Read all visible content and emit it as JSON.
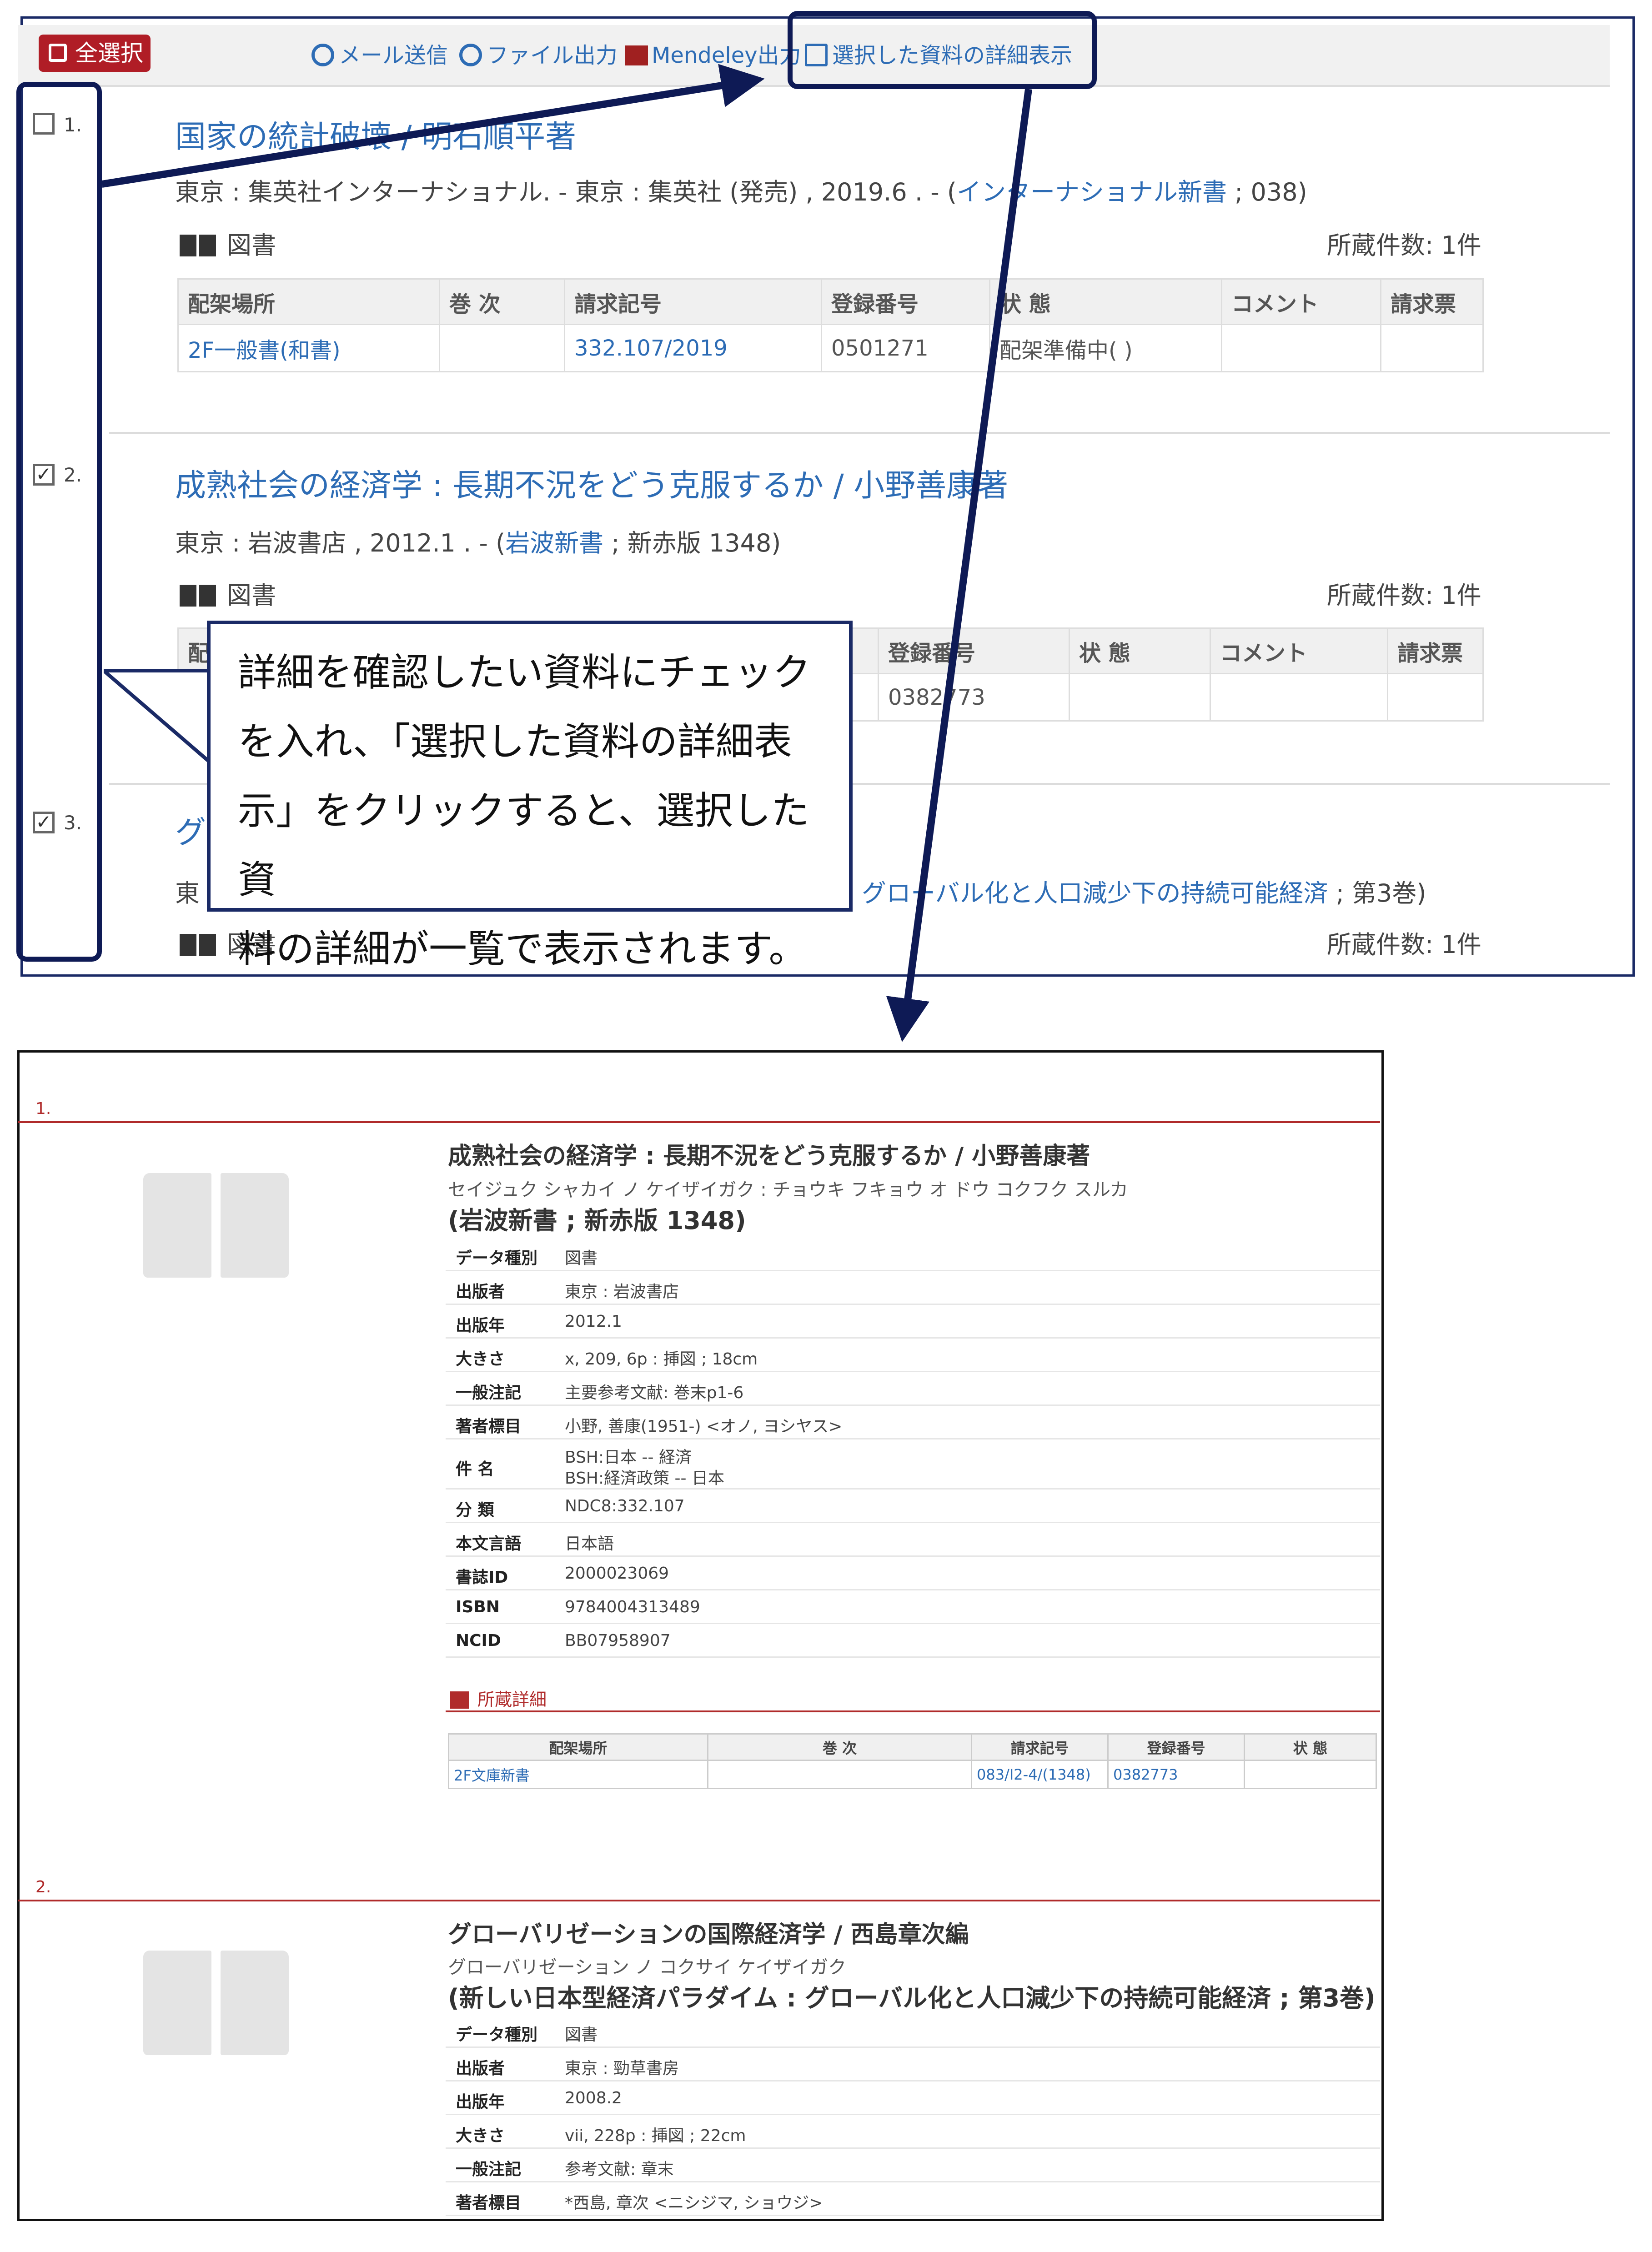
{
  "toolbar": {
    "select_all": "全選択",
    "mail": "メール送信",
    "file": "ファイル出力",
    "mendeley": "Mendeley出力",
    "detail": "選択した資料の詳細表示"
  },
  "results": [
    {
      "num": "1.",
      "checked": false,
      "title": "国家の統計破壊 / 明石順平著",
      "pub_plain": "東京 : 集英社インターナショナル. - 東京 : 集英社 (発売) , 2019.6 . - (",
      "pub_link": "インターナショナル新書",
      "pub_tail": "; 038)",
      "kind": "図書",
      "count": "所蔵件数: 1件",
      "holdings": {
        "headers": [
          "配架場所",
          "巻 次",
          "請求記号",
          "登録番号",
          "状 態",
          "コメント",
          "請求票"
        ],
        "row": [
          "2F一般書(和書)",
          "",
          "332.107/2019",
          "0501271",
          "配架準備中( )",
          "",
          ""
        ]
      }
    },
    {
      "num": "2.",
      "checked": true,
      "title": "成熟社会の経済学 : 長期不況をどう克服するか / 小野善康著",
      "pub_plain": "東京 : 岩波書店 , 2012.1 . - (",
      "pub_link": "岩波新書",
      "pub_tail": "; 新赤版 1348)",
      "kind": "図書",
      "count": "所蔵件数: 1件",
      "holdings": {
        "headers": [
          "配",
          "登録番号",
          "状 態",
          "コメント",
          "請求票"
        ],
        "row": [
          "",
          "0382773",
          "",
          "",
          ""
        ]
      }
    },
    {
      "num": "3.",
      "checked": true,
      "title": "グ",
      "pub_plain": "東",
      "pub_link": "グローバル化と人口減少下の持続可能経済",
      "pub_tail": "; 第3巻)",
      "kind": "図書",
      "count": "所蔵件数: 1件"
    }
  ],
  "callout": {
    "lines": [
      "詳細を確認したい資料にチェック",
      "を入れ、「選択した資料の詳細表",
      "示」をクリックすると、選択した資",
      "料の詳細が一覧で表示されます。"
    ]
  },
  "detail": {
    "items": [
      {
        "index": "1.",
        "title": "成熟社会の経済学 : 長期不況をどう克服するか / 小野善康著",
        "kana": "セイジュク シャカイ ノ ケイザイガク : チョウキ フキョウ オ ドウ コクフク スルカ",
        "series": "(岩波新書 ; 新赤版 1348)",
        "rows": [
          {
            "k": "データ種別",
            "v": "図書"
          },
          {
            "k": "出版者",
            "v": "東京 : 岩波書店"
          },
          {
            "k": "出版年",
            "v": "2012.1"
          },
          {
            "k": "大きさ",
            "v": "x, 209, 6p : 挿図 ; 18cm"
          },
          {
            "k": "一般注記",
            "v": "主要参考文献: 巻末p1-6"
          },
          {
            "k": "著者標目",
            "v": "小野, 善康(1951-) <オノ, ヨシヤス>"
          },
          {
            "k": "件 名",
            "v": "BSH:日本 -- 経済",
            "v2": "BSH:経済政策 -- 日本"
          },
          {
            "k": "分 類",
            "v": "NDC8:332.107"
          },
          {
            "k": "本文言語",
            "v": "日本語"
          },
          {
            "k": "書誌ID",
            "v": "2000023069"
          },
          {
            "k": "ISBN",
            "v": "9784004313489"
          },
          {
            "k": "NCID",
            "v": "BB07958907"
          }
        ],
        "holdings_title": "所蔵詳細",
        "holdings_headers": [
          "配架場所",
          "巻 次",
          "請求記号",
          "登録番号",
          "状 態"
        ],
        "holdings_row": [
          "2F文庫新書",
          "",
          "083/I2-4/(1348)",
          "0382773",
          ""
        ]
      },
      {
        "index": "2.",
        "title": "グローバリゼーションの国際経済学 / 西島章次編",
        "kana": "グローバリゼーション ノ コクサイ ケイザイガク",
        "series": "(新しい日本型経済パラダイム : グローバル化と人口減少下の持続可能経済 ; 第3巻)",
        "rows": [
          {
            "k": "データ種別",
            "v": "図書"
          },
          {
            "k": "出版者",
            "v": "東京 : 勁草書房"
          },
          {
            "k": "出版年",
            "v": "2008.2"
          },
          {
            "k": "大きさ",
            "v": "vii, 228p : 挿図 ; 22cm"
          },
          {
            "k": "一般注記",
            "v": "参考文献: 章末"
          },
          {
            "k": "著者標目",
            "v": "*西島, 章次 <ニシジマ, ショウジ>"
          }
        ]
      }
    ]
  },
  "colors": {
    "accent": "#2d6cb5",
    "brand_red": "#b01d26",
    "annotation_navy": "#1a2a66"
  }
}
